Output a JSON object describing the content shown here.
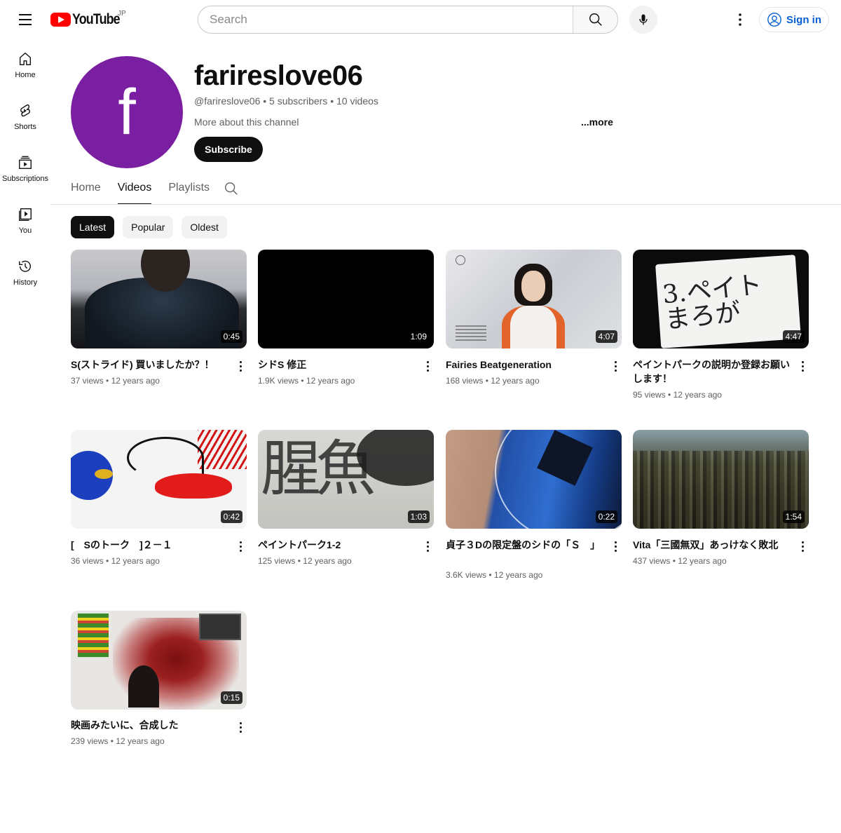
{
  "header": {
    "logo_text": "YouTube",
    "logo_region": "JP",
    "search_placeholder": "Search",
    "signin_label": "Sign in"
  },
  "rail": {
    "items": [
      {
        "label": "Home",
        "icon": "home-icon"
      },
      {
        "label": "Shorts",
        "icon": "shorts-icon"
      },
      {
        "label": "Subscriptions",
        "icon": "subscriptions-icon"
      },
      {
        "label": "You",
        "icon": "you-icon"
      },
      {
        "label": "History",
        "icon": "history-icon"
      }
    ]
  },
  "channel": {
    "avatar_letter": "f",
    "avatar_color": "#7b1fa2",
    "name": "farireslove06",
    "meta": "@farireslove06 • 5 subscribers • 10 videos",
    "about": "More about this channel",
    "more": "...more",
    "subscribe_label": "Subscribe"
  },
  "tabs": [
    {
      "label": "Home",
      "active": false
    },
    {
      "label": "Videos",
      "active": true
    },
    {
      "label": "Playlists",
      "active": false
    }
  ],
  "chips": [
    {
      "label": "Latest",
      "active": true
    },
    {
      "label": "Popular",
      "active": false
    },
    {
      "label": "Oldest",
      "active": false
    }
  ],
  "videos": [
    {
      "title": "S(ストライド) 買いましたか？！",
      "views": "37 views",
      "age": "12 years ago",
      "duration": "0:45"
    },
    {
      "title": "シドS 修正",
      "views": "1.9K views",
      "age": "12 years ago",
      "duration": "1:09"
    },
    {
      "title": "Fairies Beatgeneration",
      "views": "168 views",
      "age": "12 years ago",
      "duration": "4:07"
    },
    {
      "title": "ペイントパークの説明か登録お願いします！",
      "views": "95 views",
      "age": "12 years ago",
      "duration": "4:47"
    },
    {
      "title": "[　Sのトーク　]２－１",
      "views": "36 views",
      "age": "12 years ago",
      "duration": "0:42"
    },
    {
      "title": "ペイントパーク1-2",
      "views": "125 views",
      "age": "12 years ago",
      "duration": "1:03"
    },
    {
      "title": "貞子３Dの限定盤のシドの「Ｓ　」",
      "views": "3.6K views",
      "age": "12 years ago",
      "duration": "0:22"
    },
    {
      "title": "Vita「三國無双」あっけなく敗北",
      "views": "437 views",
      "age": "12 years ago",
      "duration": "1:54"
    },
    {
      "title": "映画みたいに、合成した",
      "views": "239 views",
      "age": "12 years ago",
      "duration": "0:15"
    }
  ],
  "meta_separator": "•"
}
